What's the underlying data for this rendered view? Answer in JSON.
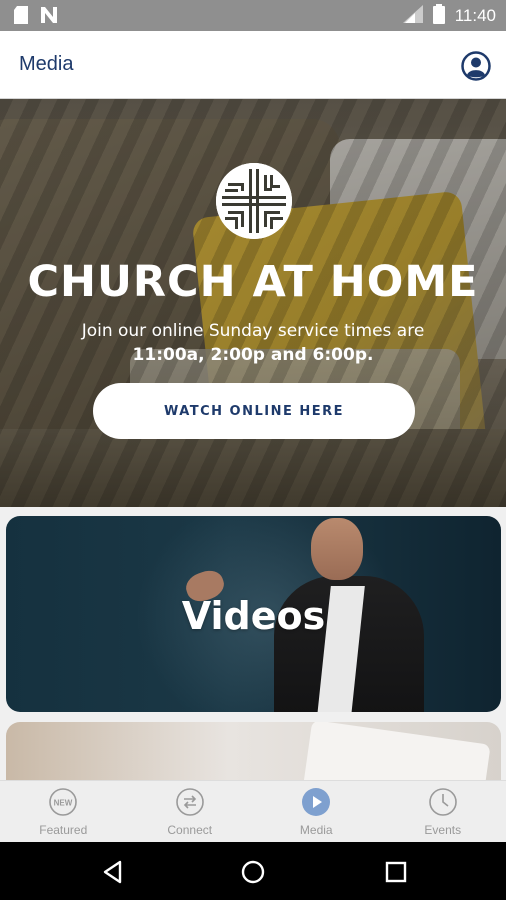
{
  "status_bar": {
    "time": "11:40",
    "icons": [
      "sd-card-icon",
      "n-notification-icon",
      "signal-icon",
      "battery-icon"
    ]
  },
  "app_bar": {
    "title": "Media",
    "profile_icon": "profile-icon"
  },
  "hero": {
    "logo_icon": "church-logo-icon",
    "title": "CHURCH AT HOME",
    "line1": "Join our online Sunday service times are",
    "line2": "11:00a, 2:00p and 6:00p.",
    "button_label": "WATCH ONLINE HERE"
  },
  "cards": [
    {
      "title": "Videos"
    },
    {
      "title": ""
    }
  ],
  "tabs": [
    {
      "label": "Featured",
      "icon": "new-badge-icon",
      "active": false
    },
    {
      "label": "Connect",
      "icon": "connect-arrows-icon",
      "active": false
    },
    {
      "label": "Media",
      "icon": "play-icon",
      "active": true
    },
    {
      "label": "Events",
      "icon": "clock-icon",
      "active": false
    }
  ],
  "colors": {
    "brand_navy": "#1e3a6b",
    "active_tab_icon": "#7ea0cf",
    "inactive_tab": "#9a9a9a",
    "status_bar": "#8f8f8f"
  },
  "nav_bar": {
    "icons": [
      "back-icon",
      "home-icon",
      "recents-icon"
    ]
  }
}
